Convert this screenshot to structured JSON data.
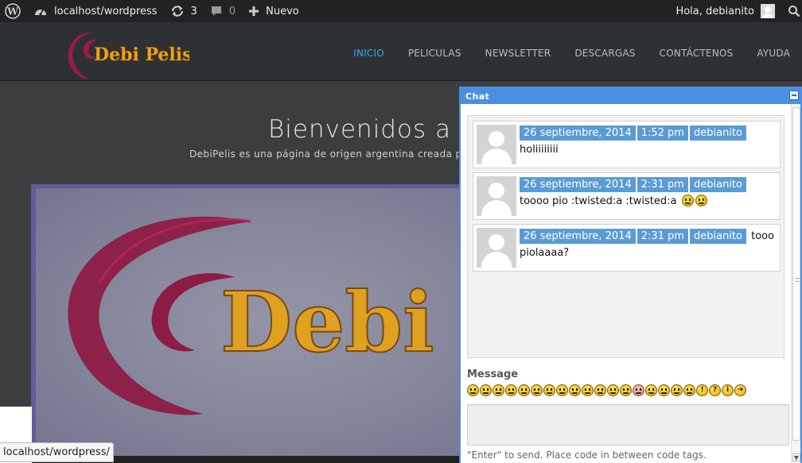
{
  "adminbar": {
    "site": "localhost/wordpress",
    "updates_count": "3",
    "comments_count": "0",
    "new_label": "Nuevo",
    "greeting": "Hola, debianito"
  },
  "header": {
    "logo_text": "Debi Pelis",
    "nav": [
      {
        "label": "INICIO",
        "active": true
      },
      {
        "label": "PELICULAS"
      },
      {
        "label": "NEWSLETTER"
      },
      {
        "label": "DESCARGAS"
      },
      {
        "label": "CONTÁCTENOS"
      },
      {
        "label": "AYUDA"
      }
    ]
  },
  "hero": {
    "title": "Bienvenidos a Debi",
    "subtitle": "DebiPelis es una página de origen argentina creada para",
    "banner_text": "Debi"
  },
  "statusbar": {
    "url": "localhost/wordpress/"
  },
  "chat": {
    "title": "Chat",
    "messages": [
      {
        "date": "26 septiembre, 2014",
        "time": "1:52 pm",
        "user": "debianito",
        "text": "holiiiiiiii"
      },
      {
        "date": "26 septiembre, 2014",
        "time": "2:31 pm",
        "user": "debianito",
        "text": "toooo pio :twisted:a :twisted:a"
      },
      {
        "date": "26 septiembre, 2014",
        "time": "2:31 pm",
        "user": "debianito",
        "text": "tooo piolaaaa?"
      }
    ],
    "message_label": "Message",
    "hint": "\"Enter\" to send. Place code in between code tags."
  },
  "colors": {
    "accent": "#3ba8e6",
    "chat_blue": "#4a90e2",
    "meta_blue": "#5b9bd5"
  },
  "icons": [
    "wordpress-icon",
    "dashboard-icon",
    "updates-icon",
    "comments-icon",
    "plus-icon",
    "search-icon",
    "minimize-icon"
  ]
}
